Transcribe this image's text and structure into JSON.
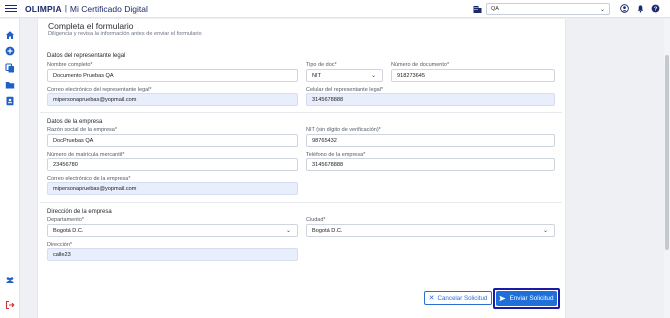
{
  "header": {
    "brand": "OLIMPIA",
    "separator": "|",
    "app_title": "Mi Certificado Digital",
    "company_selected": "QA"
  },
  "form": {
    "title": "Completa el formulario",
    "subtitle": "Diligencia y revisa la información antes de enviar el formulario",
    "representante": {
      "section_title": "Datos del representante legal",
      "nombre_label": "Nombre completo*",
      "nombre_value": "Documento Pruebas QA",
      "tipo_doc_label": "Tipo de doc*",
      "tipo_doc_value": "NIT",
      "numero_doc_label": "Número de documento*",
      "numero_doc_value": "918273645",
      "correo_label": "Correo electrónico del representante legal*",
      "correo_value": "mipersonapruebas@yopmail.com",
      "celular_label": "Celular del representante legal*",
      "celular_value": "3145678888"
    },
    "empresa": {
      "section_title": "Datos de la empresa",
      "razon_label": "Razón social de la empresa*",
      "razon_value": "DocPruebas QA",
      "nit_label": "NIT (sin dígito de verificación)*",
      "nit_value": "98765432",
      "matricula_label": "Número de matrícula mercantil*",
      "matricula_value": "23456780",
      "telefono_label": "Teléfono de la empresa*",
      "telefono_value": "3145678888",
      "correo_label": "Correo electrónico de la empresa*",
      "correo_value": "mipersonapruebas@yopmail.com"
    },
    "direccion": {
      "section_title": "Dirección de la empresa",
      "departamento_label": "Departamento*",
      "departamento_value": "Bogotá D.C.",
      "ciudad_label": "Ciudad*",
      "ciudad_value": "Bogotá D.C.",
      "direccion_label": "Dirección*",
      "direccion_value": "calle23"
    }
  },
  "actions": {
    "cancel_label": "Cancelar Solicitud",
    "send_label": "Enviar Solicitud"
  },
  "colors": {
    "primary": "#1e6fd9",
    "brand_navy": "#1b2a6b",
    "focus_outline": "#1a1aa8",
    "filled_field": "#e8eefb"
  }
}
